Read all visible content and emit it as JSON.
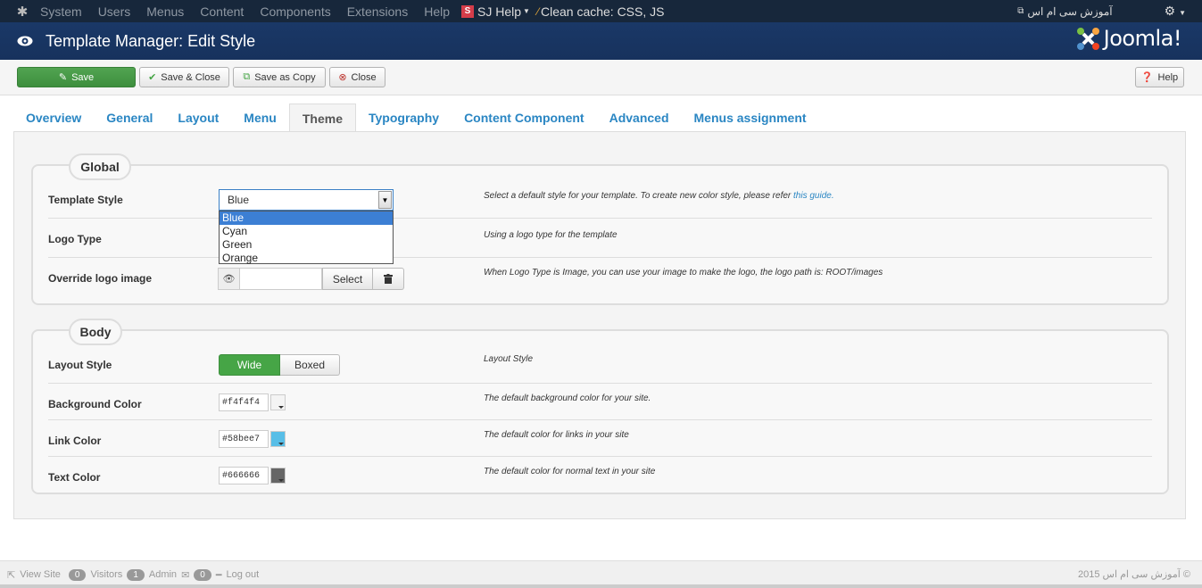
{
  "topnav": {
    "items": [
      "System",
      "Users",
      "Menus",
      "Content",
      "Components",
      "Extensions",
      "Help"
    ],
    "sj_help": "SJ Help",
    "clean_cache": "Clean cache: CSS, JS",
    "site_link": "آموزش سی ام اس"
  },
  "header": {
    "title": "Template Manager: Edit Style",
    "brand": "Joomla!"
  },
  "toolbar": {
    "save": "Save",
    "save_close": "Save & Close",
    "save_copy": "Save as Copy",
    "close": "Close",
    "help": "Help"
  },
  "tabs": [
    "Overview",
    "General",
    "Layout",
    "Menu",
    "Theme",
    "Typography",
    "Content Component",
    "Advanced",
    "Menus assignment"
  ],
  "active_tab": "Theme",
  "global": {
    "legend": "Global",
    "template_style": {
      "label": "Template Style",
      "value": "Blue",
      "options": [
        "Blue",
        "Cyan",
        "Green",
        "Orange"
      ],
      "desc": "Select a default style for your template. To create new color style, please refer",
      "desc_link": "this guide."
    },
    "logo_type": {
      "label": "Logo Type",
      "desc": "Using a logo type for the template"
    },
    "override_logo": {
      "label": "Override logo image",
      "select": "Select",
      "desc": "When Logo Type is Image, you can use your image to make the logo, the logo path is: ROOT/images"
    }
  },
  "body": {
    "legend": "Body",
    "layout_style": {
      "label": "Layout Style",
      "options": [
        "Wide",
        "Boxed"
      ],
      "selected": "Wide",
      "desc": "Layout Style"
    },
    "background_color": {
      "label": "Background Color",
      "value": "#f4f4f4",
      "desc": "The default background color for your site."
    },
    "link_color": {
      "label": "Link Color",
      "value": "#58bee7",
      "desc": "The default color for links in your site"
    },
    "text_color": {
      "label": "Text Color",
      "value": "#666666",
      "desc": "The default color for normal text in your site"
    }
  },
  "footer": {
    "view_site": "View Site",
    "visitors_count": "0",
    "visitors": "Visitors",
    "admin_count": "1",
    "admin": "Admin",
    "messages_count": "0",
    "logout": "Log out",
    "copyright": "آموزش سی ام اس 2015 ©"
  },
  "colors": {
    "navbar": "#17273b",
    "header": "#1a3867",
    "save_green": "#51a351",
    "link_blue": "#2a86c3"
  }
}
